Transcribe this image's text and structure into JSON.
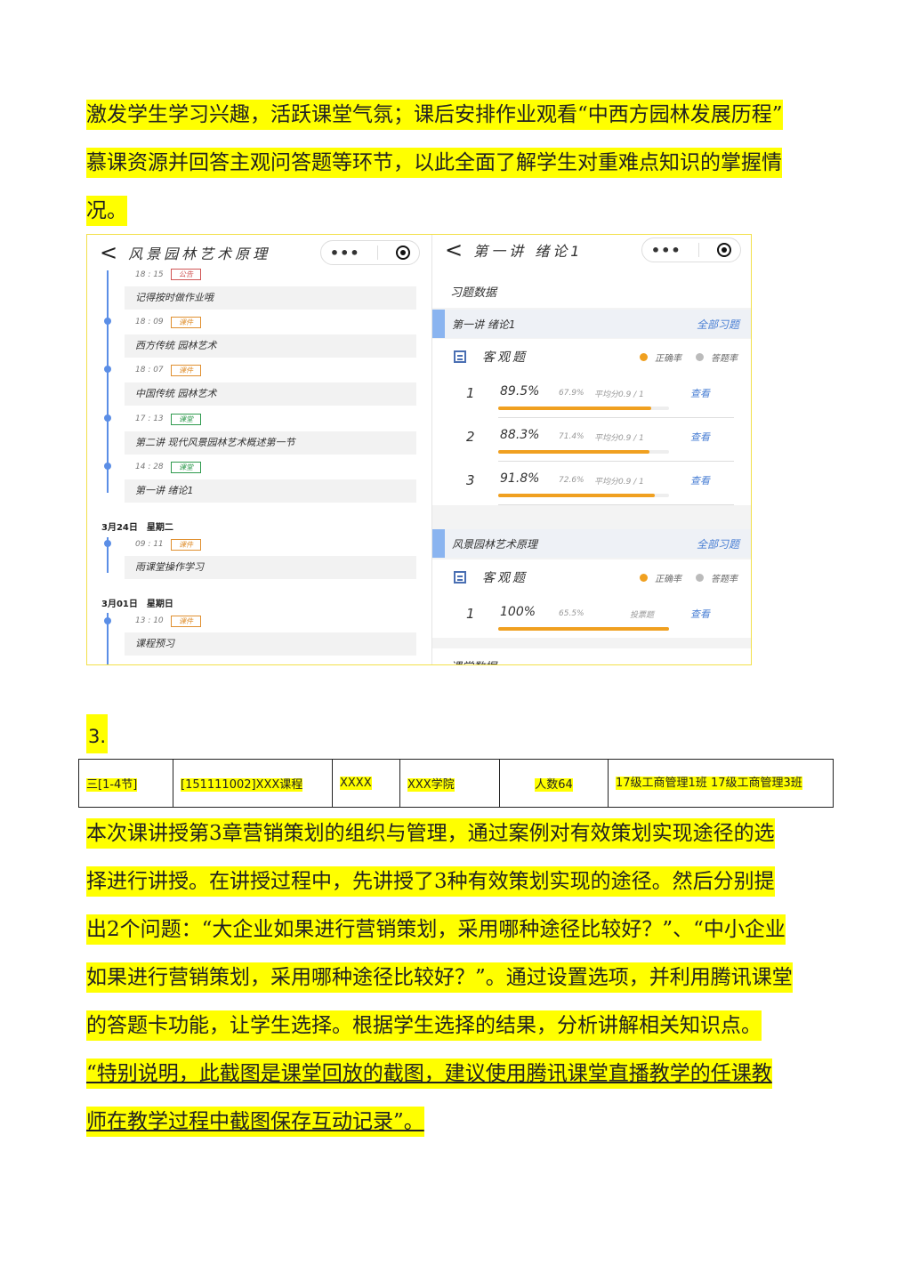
{
  "intro_paragraph": {
    "lines": [
      "激发学生学习兴趣，活跃课堂气氛；课后安排作业观看“中西方园林发展历程”",
      "慕课资源并回答主观问答题等环节，以此全面了解学生对重难点知识的掌握情",
      "况。"
    ]
  },
  "screenshot": {
    "left_panel": {
      "back_glyph": "<",
      "title": "风景园林艺术原理",
      "capsule_dots": "•••",
      "timeline": [
        {
          "time": "18 : 15",
          "tag": "公告",
          "tag_color": "red",
          "text": "记得按时做作业哦"
        },
        {
          "time": "18 : 09",
          "tag": "课件",
          "tag_color": "orange",
          "text": "西方传统 园林艺术"
        },
        {
          "time": "18 : 07",
          "tag": "课件",
          "tag_color": "orange",
          "text": "中国传统 园林艺术"
        },
        {
          "time": "17 : 13",
          "tag": "课堂",
          "tag_color": "green",
          "text": "第二讲 现代风景园林艺术概述第一节"
        },
        {
          "time": "14 : 28",
          "tag": "课堂",
          "tag_color": "green",
          "text": "第一讲 绪论1"
        }
      ],
      "date_1": "3月24日　星期二",
      "timeline_2": [
        {
          "time": "09 : 11",
          "tag": "课件",
          "tag_color": "orange",
          "text": "雨课堂操作学习"
        }
      ],
      "date_2": "3月01日　星期日",
      "timeline_3": [
        {
          "time": "13 : 10",
          "tag": "课件",
          "tag_color": "orange",
          "text": "课程预习"
        }
      ]
    },
    "right_panel": {
      "back_glyph": "<",
      "title": "第一讲 绪论1",
      "capsule_dots": "•••",
      "section_label": "习题数据",
      "sections": [
        {
          "name": "第一讲 绪论1",
          "all_link": "全部习题",
          "obj_label": "客观题",
          "legend_correct": "正确率",
          "legend_answer": "答题率",
          "questions": [
            {
              "num": "1",
              "pct": "89.5%",
              "sub": "67.9%",
              "avg": "平均分0.9 / 1",
              "view": "查看",
              "fill": 0.895
            },
            {
              "num": "2",
              "pct": "88.3%",
              "sub": "71.4%",
              "avg": "平均分0.9 / 1",
              "view": "查看",
              "fill": 0.883
            },
            {
              "num": "3",
              "pct": "91.8%",
              "sub": "72.6%",
              "avg": "平均分0.9 / 1",
              "view": "查看",
              "fill": 0.918
            }
          ]
        },
        {
          "name": "风景园林艺术原理",
          "all_link": "全部习题",
          "obj_label": "客观题",
          "legend_correct": "正确率",
          "legend_answer": "答题率",
          "questions": [
            {
              "num": "1",
              "pct": "100%",
              "sub": "65.5%",
              "avg": "投票题",
              "view": "查看",
              "fill": 1.0
            }
          ]
        }
      ],
      "footer_cut": "课堂数据"
    },
    "colors": {
      "accent_blue": "#5b8ee6",
      "bar_orange": "#f0a020",
      "link_blue": "#4a7fd4"
    }
  },
  "section_number": "3.",
  "info_table": {
    "cells": [
      "三[1-4节]",
      "[151111002]XXX课程",
      "XXXX",
      "XXX学院",
      "人数64",
      "17级工商管理1班 17级工商管理3班"
    ]
  },
  "body_paragraph": {
    "lines": [
      "本次课讲授第3章营销策划的组织与管理，通过案例对有效策划实现途径的选",
      "择进行讲授。在讲授过程中，先讲授了3种有效策划实现的途径。然后分别提",
      "出2个问题：“大企业如果进行营销策划，采用哪种途径比较好？”、“中小企业",
      "如果进行营销策划，采用哪种途径比较好？”。通过设置选项，并利用腾讯课堂",
      "的答题卡功能，让学生选择。根据学生选择的结果，分析讲解相关知识点。"
    ]
  },
  "note_paragraph": {
    "lines": [
      "“特别说明，此截图是课堂回放的截图，建议使用腾讯课堂直播教学的任课教",
      "师在教学过程中截图保存互动记录”。"
    ]
  },
  "highlight_color": "#ffff00"
}
